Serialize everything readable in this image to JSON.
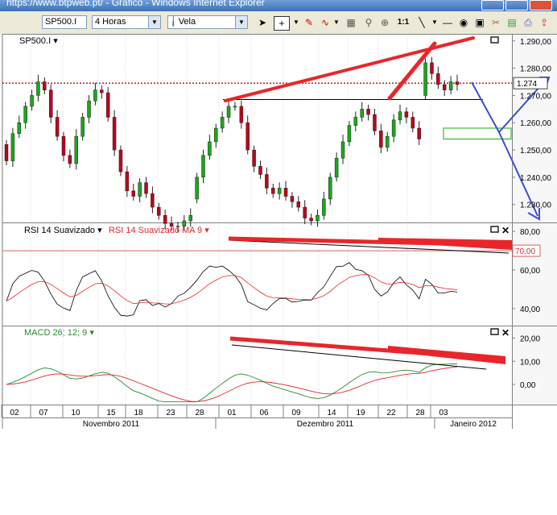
{
  "window": {
    "title": "https://www.btpweb.pt/ - Gráfico - Windows Internet Explorer"
  },
  "toolbar": {
    "symbol": "SP500.I",
    "timeframe": "4 Horas",
    "chart_style": "Vela",
    "ratio_label": "1:1"
  },
  "colors": {
    "bull": "#1aa81a",
    "bear": "#c0001a",
    "annotation_red": "#e8262a",
    "annotation_blue": "#3a4fd0",
    "rsi_line": "#000000",
    "rsi_ma": "#e8262a",
    "macd_line": "#2e8b2e",
    "macd_signal": "#e8262a"
  },
  "chart_data": [
    {
      "type": "candlestick",
      "panel": "price",
      "symbol_label": "SP500.I",
      "y_ticks": [
        "1.290,00",
        "1.280,00",
        "1.270,00",
        "1.260,00",
        "1.250,00",
        "1.240,00",
        "1.230,00"
      ],
      "ylim": [
        1224,
        1292
      ],
      "current_value": "1.274",
      "series": [
        {
          "name": "Nov",
          "start": 1252,
          "points": [
            1246,
            1256,
            1260,
            1266,
            1270,
            1275,
            1272,
            1262,
            1255,
            1248,
            1245,
            1255,
            1262,
            1268,
            1272,
            1271,
            1262,
            1250,
            1242,
            1235,
            1233,
            1238,
            1234,
            1229,
            1226,
            1223,
            1222,
            1222,
            1224,
            1226
          ]
        },
        {
          "name": "Dec",
          "start": 1232,
          "points": [
            1240,
            1248,
            1253,
            1258,
            1262,
            1266,
            1266,
            1260,
            1250,
            1244,
            1241,
            1236,
            1234,
            1236,
            1233,
            1231,
            1229,
            1225,
            1224,
            1226,
            1232,
            1240,
            1247,
            1253,
            1259,
            1262,
            1265,
            1263,
            1257,
            1251,
            1255,
            1261,
            1264,
            1262,
            1258,
            1254
          ]
        },
        {
          "name": "Jan",
          "start": 1270,
          "points": [
            1282,
            1278,
            1274,
            1272,
            1275,
            1274
          ]
        }
      ]
    },
    {
      "type": "line",
      "panel": "rsi",
      "title": "RSI 14 Suavizado",
      "ma_title": "RSI 14 Suavizado MA 9",
      "y_ticks": [
        "80,00",
        "60,00",
        "40,00"
      ],
      "overbought_label": "70,00",
      "ylim": [
        32,
        83
      ]
    },
    {
      "type": "line",
      "panel": "macd",
      "title": "MACD 26; 12; 9",
      "y_ticks": [
        "20,00",
        "10,00",
        "0,00"
      ],
      "ylim": [
        -8,
        24
      ]
    },
    {
      "type": "axis",
      "x_ticks": [
        "02",
        "07",
        "10",
        "15",
        "18",
        "23",
        "28",
        "01",
        "06",
        "09",
        "14",
        "19",
        "22",
        "28",
        "03"
      ],
      "months": [
        "Novembro 2011",
        "Dezembro 2011",
        "Janeiro 2012"
      ]
    }
  ]
}
